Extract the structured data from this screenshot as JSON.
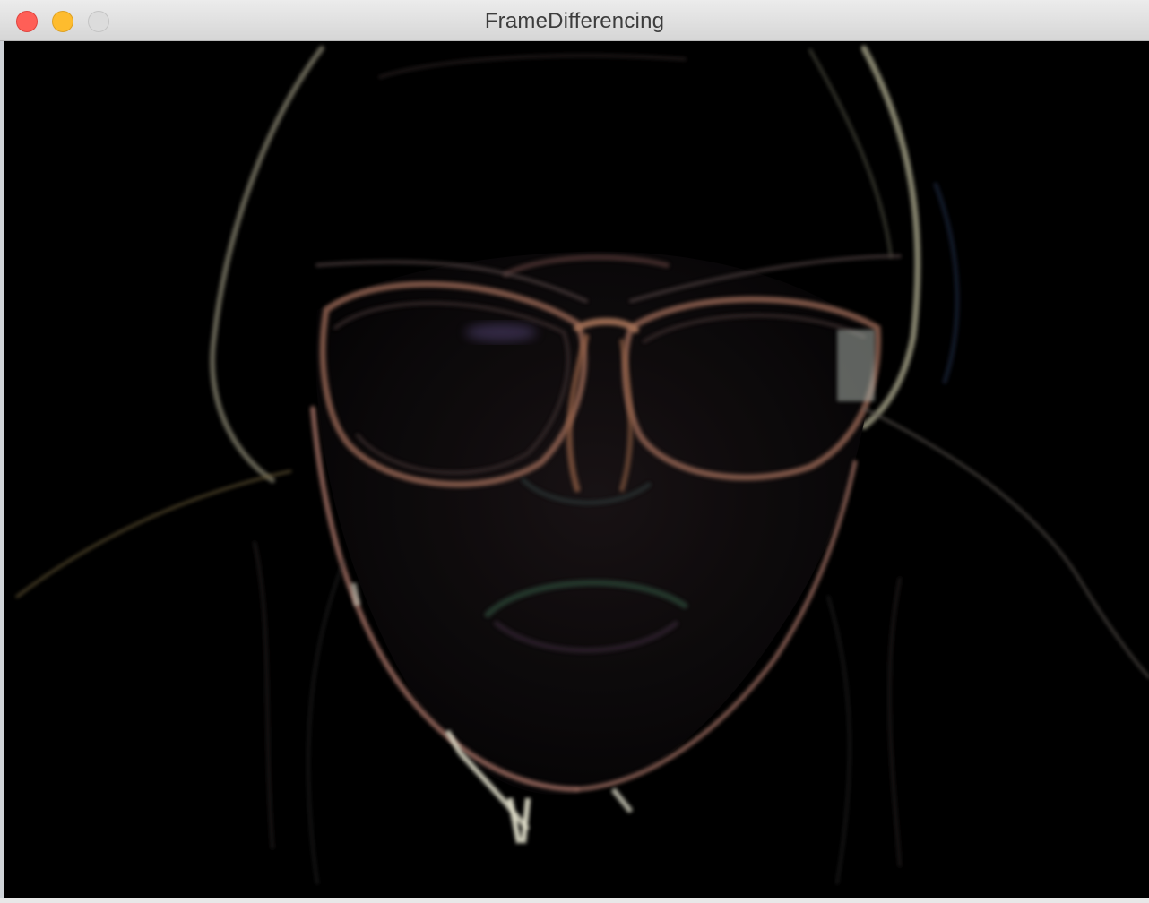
{
  "window": {
    "title": "FrameDifferencing"
  },
  "controls": {
    "close": "close-window",
    "minimize": "minimize-window",
    "zoom": "zoom-window"
  },
  "canvas": {
    "description_icon": "frame-difference-video-icon"
  },
  "colors": {
    "close": "#ff5f57",
    "minimize": "#febc2e",
    "zoom": "#dcdcdc",
    "canvas_bg": "#000000"
  }
}
